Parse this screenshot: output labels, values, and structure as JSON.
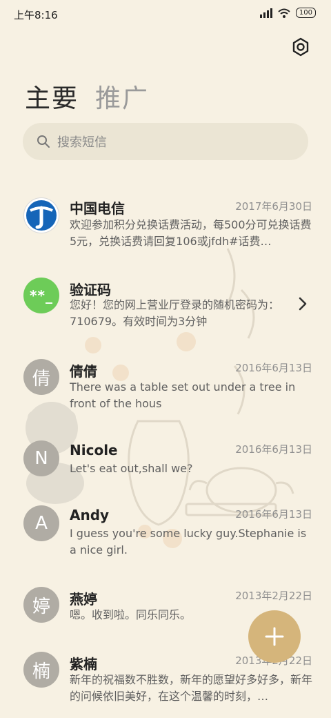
{
  "status": {
    "time": "上午8:16",
    "battery": "100"
  },
  "tabs": {
    "primary": "主要",
    "promo": "推广"
  },
  "search": {
    "placeholder": "搜索短信"
  },
  "conversations": [
    {
      "name": "中国电信",
      "date": "2017年6月30日",
      "snippet": "欢迎参加积分兑换话费活动，每500分可兑换话费5元，兑换话费请回复106或jfdh#话费…",
      "avatar": "telecom-logo"
    },
    {
      "name": "验证码",
      "date": "",
      "snippet": "您好！您的网上营业厅登录的随机密码为：710679。有效时间为3分钟",
      "avatar_text": "**_",
      "avatar_color": "#6dcc58"
    },
    {
      "name": "倩倩",
      "date": "2016年6月13日",
      "snippet": "There was a table set out under a tree in front of the hous",
      "avatar_text": "倩"
    },
    {
      "name": "Nicole",
      "date": "2016年6月13日",
      "snippet": "Let's eat out,shall we?",
      "avatar_text": "N"
    },
    {
      "name": "Andy",
      "date": "2016年6月13日",
      "snippet": "I guess you're some lucky guy.Stephanie is a nice girl.",
      "avatar_text": "A"
    },
    {
      "name": "燕婷",
      "date": "2013年2月22日",
      "snippet": "嗯。收到啦。同乐同乐。",
      "avatar_text": "婷"
    },
    {
      "name": "紫楠",
      "date": "2013年2月22日",
      "snippet": "新年的祝福数不胜数，新年的愿望好多好多，新年的问候依旧美好，在这个温馨的时刻，…",
      "avatar_text": "楠"
    }
  ],
  "colors": {
    "background": "#f7f1e3",
    "fab": "#d5b57b",
    "avatar_gray": "#b0aca4"
  }
}
